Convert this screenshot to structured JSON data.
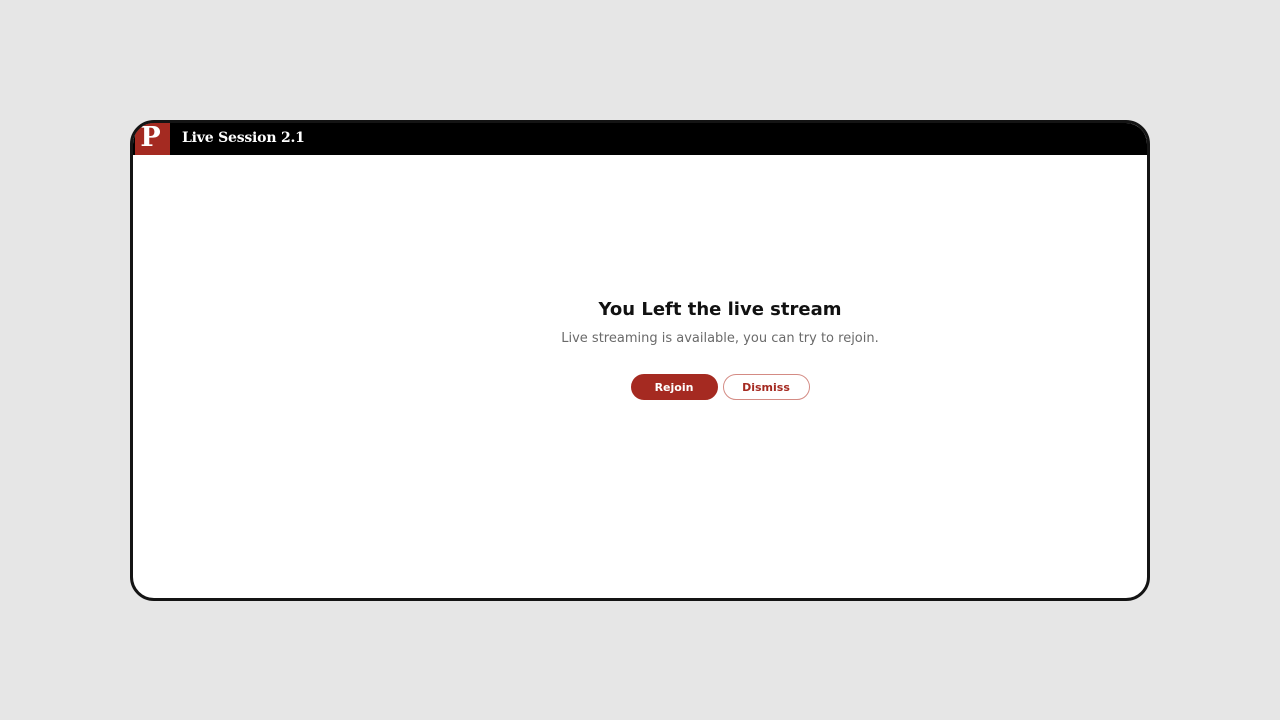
{
  "window": {
    "title": "Live Session 2.1",
    "logo_letter": "P"
  },
  "dialog": {
    "heading": "You Left the live stream",
    "message": "Live streaming is available, you can try to rejoin.",
    "primary_button": "Rejoin",
    "secondary_button": "Dismiss"
  },
  "colors": {
    "accent": "#a52a21",
    "titlebar": "#000000",
    "background": "#e6e6e6"
  }
}
